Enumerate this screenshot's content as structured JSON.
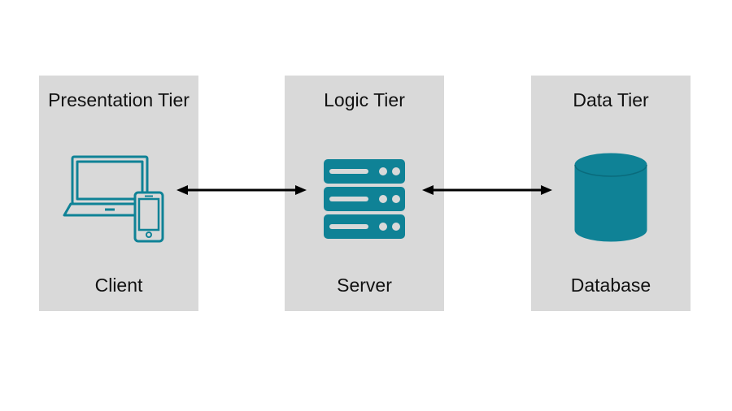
{
  "diagram": {
    "tiers": [
      {
        "title": "Presentation Tier",
        "subtitle": "Client",
        "icon": "client-devices"
      },
      {
        "title": "Logic Tier",
        "subtitle": "Server",
        "icon": "server-stack"
      },
      {
        "title": "Data Tier",
        "subtitle": "Database",
        "icon": "database-cylinder"
      }
    ],
    "arrows": [
      {
        "from": "presentation",
        "to": "logic",
        "bidirectional": true
      },
      {
        "from": "logic",
        "to": "data",
        "bidirectional": true
      }
    ],
    "colors": {
      "accent": "#0f8296",
      "box": "#d9d9d9",
      "arrow": "#000000"
    }
  }
}
